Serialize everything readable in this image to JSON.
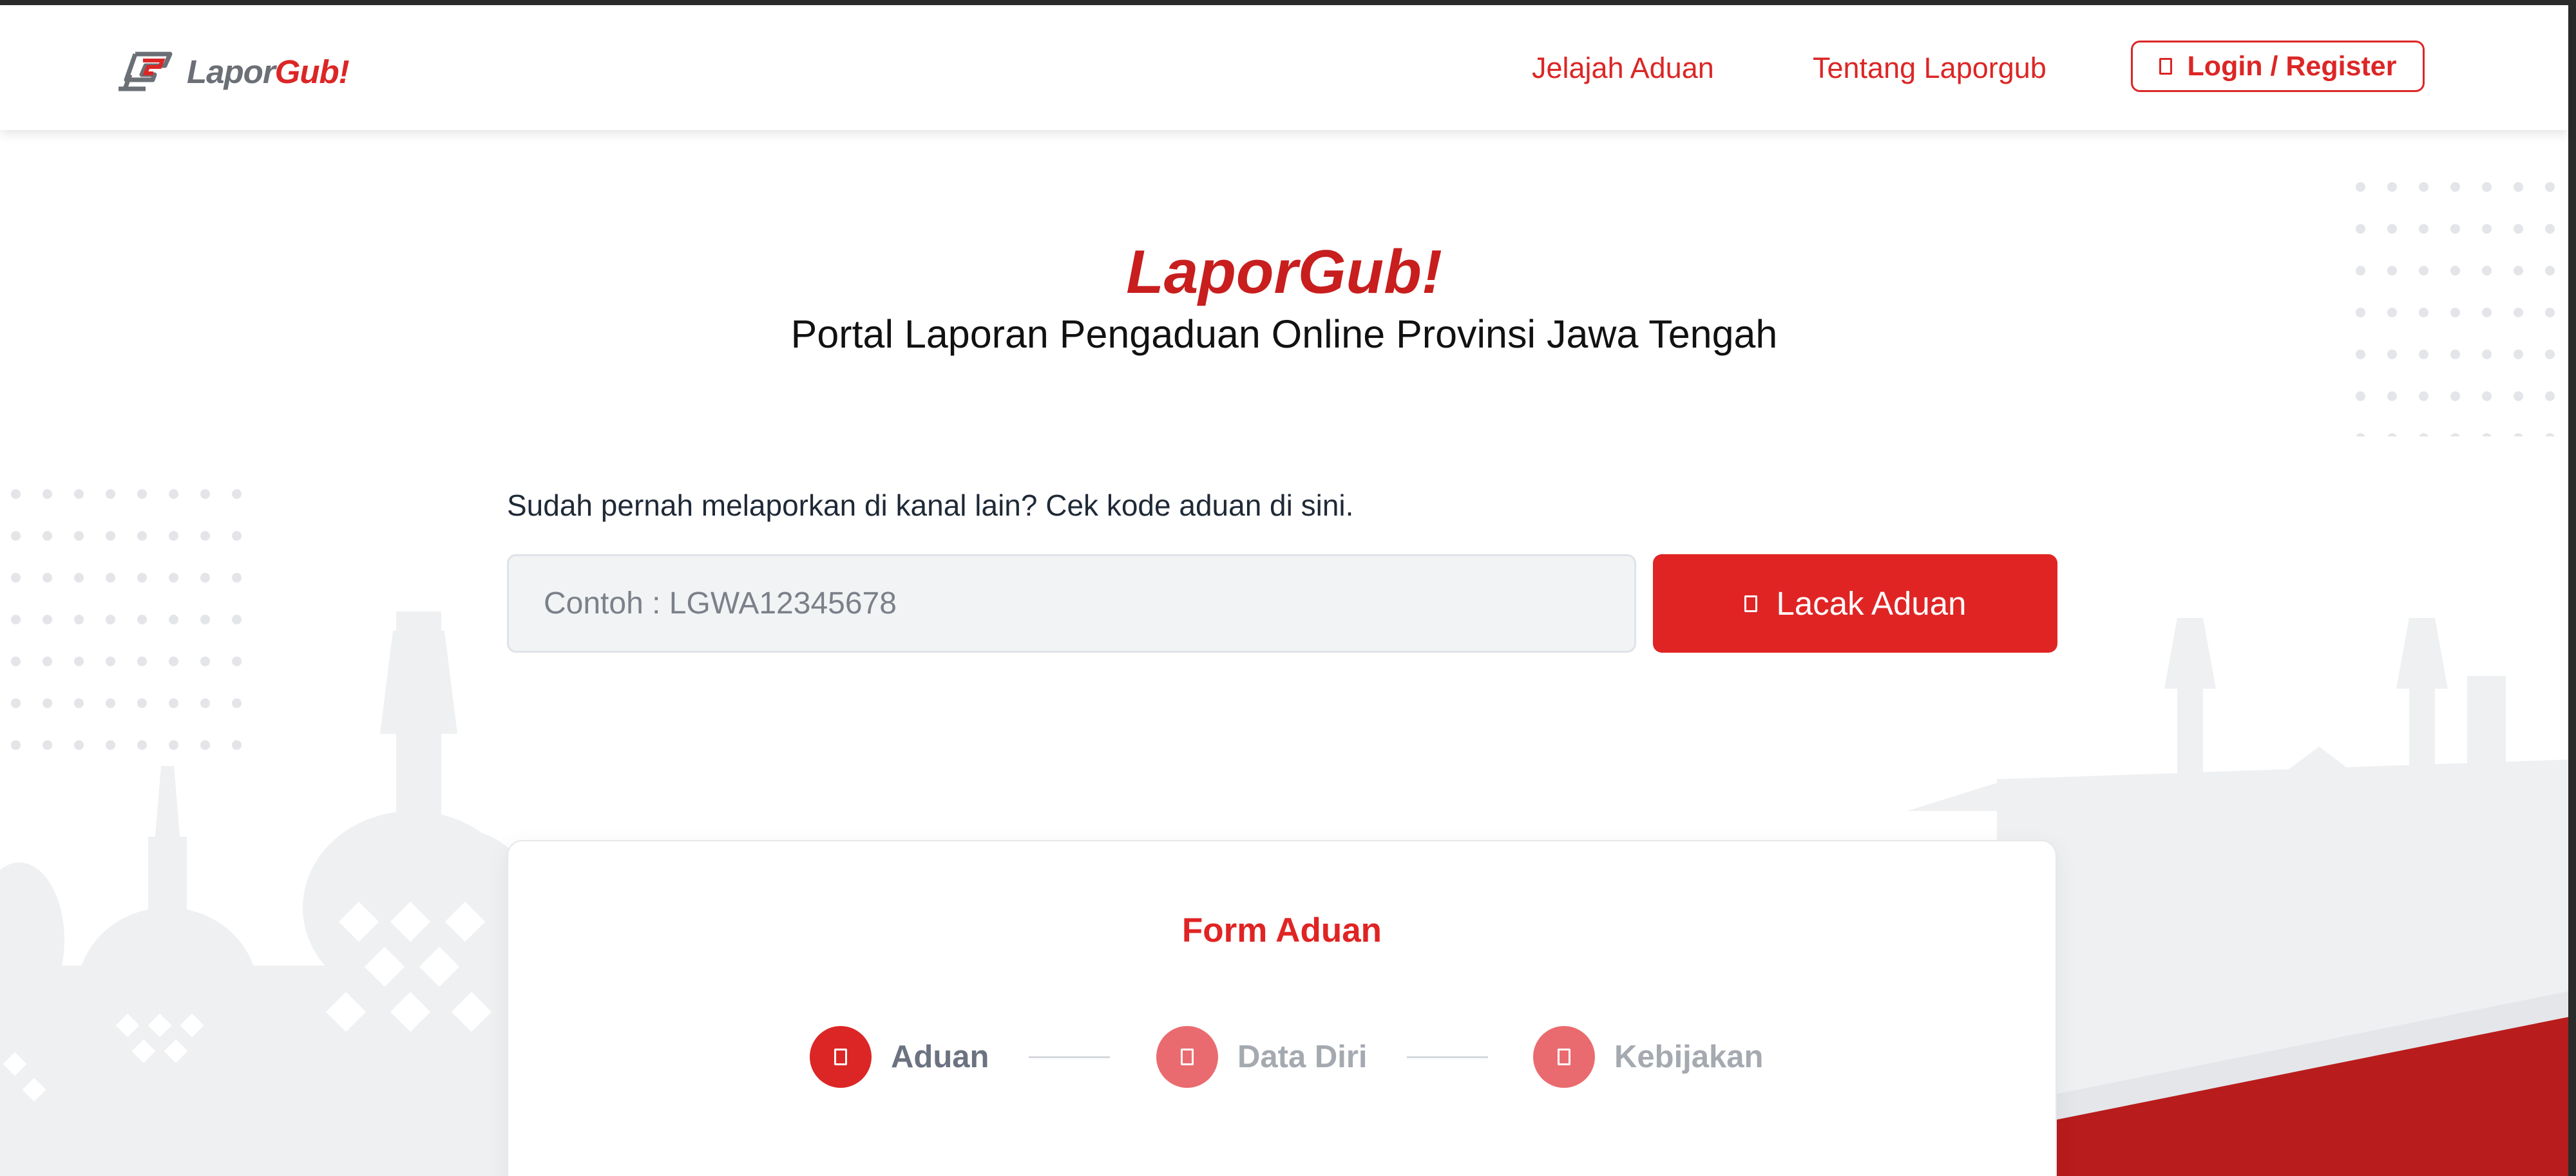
{
  "brand": {
    "part1": "Lapor",
    "part2": "Gub!"
  },
  "nav": {
    "links": [
      {
        "label": "Jelajah Aduan"
      },
      {
        "label": "Tentang Laporgub"
      }
    ],
    "login_label": "Login / Register"
  },
  "hero": {
    "title": "LaporGub!",
    "subtitle": "Portal Laporan Pengaduan Online Provinsi Jawa Tengah"
  },
  "track": {
    "prompt": "Sudah pernah melaporkan di kanal lain? Cek kode aduan di sini.",
    "input_value": "",
    "placeholder": "Contoh : LGWA12345678",
    "button_label": "Lacak Aduan"
  },
  "form": {
    "title": "Form Aduan",
    "steps": [
      {
        "label": "Aduan",
        "state": "active"
      },
      {
        "label": "Data Diri",
        "state": "pending"
      },
      {
        "label": "Kebijakan",
        "state": "pending"
      }
    ]
  },
  "colors": {
    "accent": "#e02424",
    "accent_dark": "#b91c1c",
    "step_active_circle": "#dc2626",
    "step_pending_circle": "#ea6b6f",
    "step_active_text": "#6b7280",
    "step_pending_text": "#a5a9b0",
    "skyline": "#eef0f2"
  }
}
